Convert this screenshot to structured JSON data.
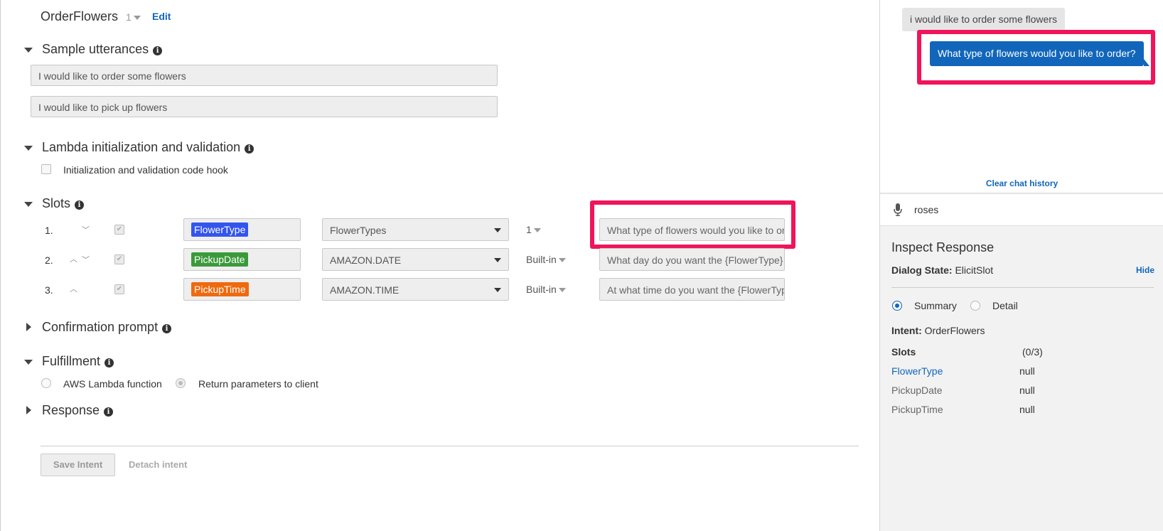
{
  "intent": {
    "name": "OrderFlowers",
    "version": "1",
    "edit_label": "Edit"
  },
  "sections": {
    "sample_utterances": {
      "title": "Sample utterances",
      "items": [
        "I would like to order some flowers",
        "I would like to pick up flowers"
      ]
    },
    "lambda_init": {
      "title": "Lambda initialization and validation",
      "checkbox_label": "Initialization and validation code hook"
    },
    "slots": {
      "title": "Slots",
      "rows": [
        {
          "num": "1.",
          "name": "FlowerType",
          "type": "FlowerTypes",
          "version": "1",
          "prompt": "What type of flowers would you like to order?",
          "color": "#3355ee"
        },
        {
          "num": "2.",
          "name": "PickupDate",
          "type": "AMAZON.DATE",
          "version": "Built-in",
          "prompt": "What day do you want the {FlowerType} to be picked up?",
          "color": "#3a9a3a"
        },
        {
          "num": "3.",
          "name": "PickupTime",
          "type": "AMAZON.TIME",
          "version": "Built-in",
          "prompt": "At what time do you want the {FlowerType} to be picked up?",
          "color": "#ee6a0f"
        }
      ]
    },
    "confirmation": {
      "title": "Confirmation prompt"
    },
    "fulfillment": {
      "title": "Fulfillment",
      "option_lambda": "AWS Lambda function",
      "option_return": "Return parameters to client"
    },
    "response": {
      "title": "Response"
    }
  },
  "footer": {
    "save_label": "Save Intent",
    "detach_label": "Detach intent"
  },
  "chat": {
    "user_message": "i would like to order some flowers",
    "bot_message": "What type of flowers would you like to order?",
    "clear_label": "Clear chat history",
    "input_value": "roses"
  },
  "inspect": {
    "title": "Inspect Response",
    "dialog_state_label": "Dialog State:",
    "dialog_state": "ElicitSlot",
    "hide_label": "Hide",
    "summary_label": "Summary",
    "detail_label": "Detail",
    "intent_label": "Intent:",
    "intent_value": "OrderFlowers",
    "slots_label": "Slots",
    "slots_count": "(0/3)",
    "slots": [
      {
        "name": "FlowerType",
        "value": "null"
      },
      {
        "name": "PickupDate",
        "value": "null"
      },
      {
        "name": "PickupTime",
        "value": "null"
      }
    ]
  },
  "colors": {
    "accent": "#1166bb",
    "highlight": "#f0145a"
  }
}
